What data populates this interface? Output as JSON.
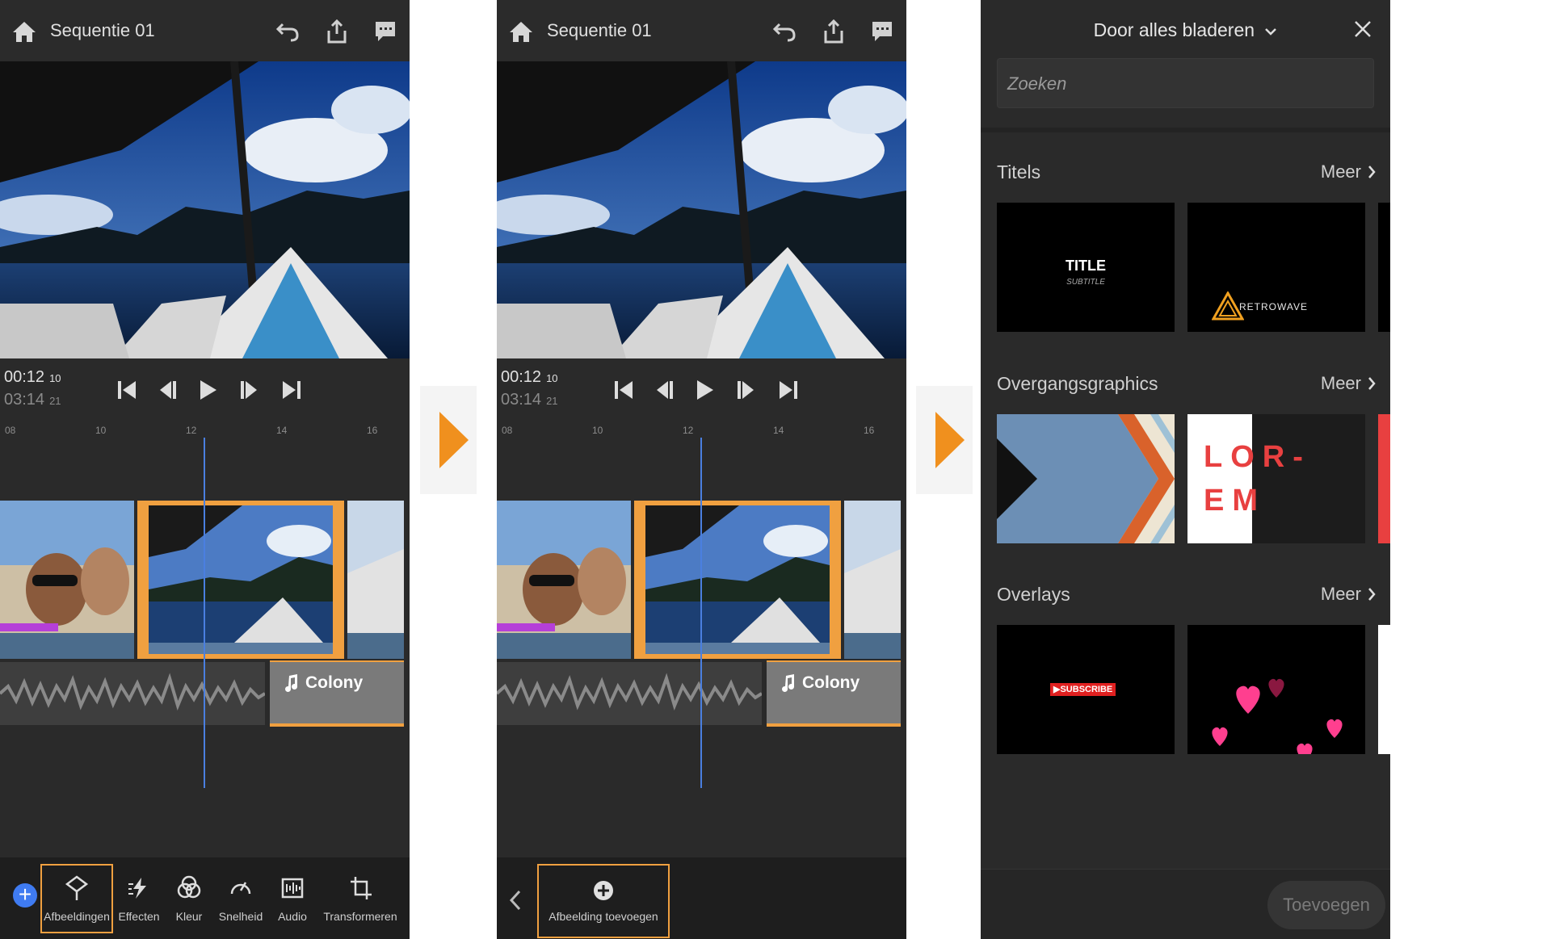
{
  "screen1": {
    "title": "Sequentie 01",
    "timecode_current": "00:12",
    "timecode_current_frame": "10",
    "timecode_total": "03:14",
    "timecode_total_frame": "21",
    "ruler_ticks": [
      "08",
      "10",
      "12",
      "14",
      "16"
    ],
    "music_label": "Colony",
    "tools": [
      {
        "label": "Afbeeldingen",
        "icon": "images-icon",
        "selected": true
      },
      {
        "label": "Effecten",
        "icon": "effects-icon",
        "selected": false
      },
      {
        "label": "Kleur",
        "icon": "color-icon",
        "selected": false
      },
      {
        "label": "Snelheid",
        "icon": "speed-icon",
        "selected": false
      },
      {
        "label": "Audio",
        "icon": "audio-icon",
        "selected": false
      },
      {
        "label": "Transformeren",
        "icon": "transform-icon",
        "selected": false
      }
    ]
  },
  "screen2": {
    "title": "Sequentie 01",
    "timecode_current": "00:12",
    "timecode_current_frame": "10",
    "timecode_total": "03:14",
    "timecode_total_frame": "21",
    "ruler_ticks": [
      "08",
      "10",
      "12",
      "14",
      "16"
    ],
    "music_label": "Colony",
    "add_image_label": "Afbeelding toevoegen"
  },
  "panel": {
    "title": "Door alles bladeren",
    "search_placeholder": "Zoeken",
    "more_label": "Meer",
    "sections": [
      {
        "title": "Titels"
      },
      {
        "title": "Overgangsgraphics"
      },
      {
        "title": "Overlays"
      }
    ],
    "thumb_texts": {
      "title_main": "TITLE",
      "title_sub": "SUBTITLE",
      "retrowave": "RETROWAVE",
      "lorem_line1": "LOR-",
      "lorem_line2": "EM",
      "subscribe": "SUBSCRIBE"
    },
    "add_button": "Toevoegen"
  },
  "colors": {
    "accent": "#f0a040",
    "playhead": "#4a7fe0",
    "background": "#2a2a2a",
    "fab": "#3f7bf1"
  }
}
